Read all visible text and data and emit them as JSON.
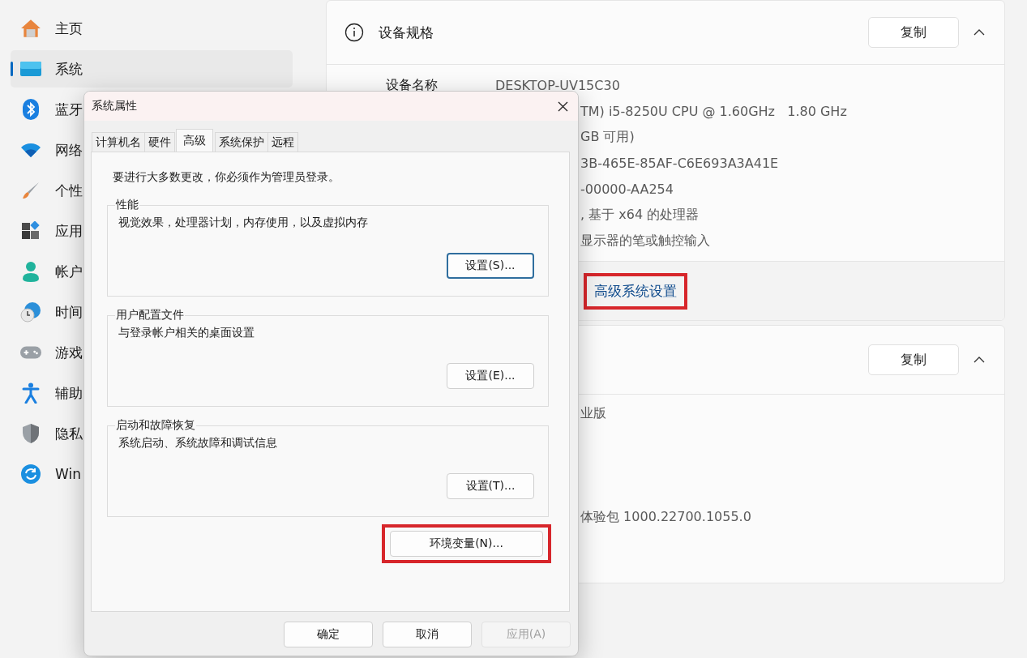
{
  "sidebar": {
    "items": [
      {
        "label": "主页",
        "selected": false
      },
      {
        "label": "系统",
        "selected": true
      },
      {
        "label": "蓝牙",
        "selected": false
      },
      {
        "label": "网络",
        "selected": false
      },
      {
        "label": "个性",
        "selected": false
      },
      {
        "label": "应用",
        "selected": false
      },
      {
        "label": "帐户",
        "selected": false
      },
      {
        "label": "时间",
        "selected": false
      },
      {
        "label": "游戏",
        "selected": false
      },
      {
        "label": "辅助",
        "selected": false
      },
      {
        "label": "隐私",
        "selected": false
      },
      {
        "label": "Win",
        "selected": false
      }
    ]
  },
  "spec_card": {
    "title": "设备规格",
    "copy_button": "复制",
    "expanded": true,
    "rows": [
      {
        "label": "设备名称",
        "value": "DESKTOP-UV15C30"
      },
      {
        "value": "TM) i5-8250U CPU @ 1.60GHz   1.80 GHz"
      },
      {
        "value": "GB 可用)"
      },
      {
        "value": "3B-465E-85AF-C6E693A3A41E"
      },
      {
        "value": "-00000-AA254"
      },
      {
        "value": ", 基于 x64 的处理器"
      },
      {
        "value": "显示器的笔或触控输入"
      }
    ],
    "link": {
      "label": "高级系统设置",
      "highlighted": true
    }
  },
  "os_card": {
    "copy_button": "复制",
    "expanded": true,
    "rows": [
      {
        "value": "业版"
      },
      {
        "value": "体验包 1000.22700.1055.0"
      }
    ]
  },
  "dialog": {
    "title": "系统属性",
    "tabs": [
      {
        "label": "计算机名",
        "selected": false
      },
      {
        "label": "硬件",
        "selected": false
      },
      {
        "label": "高级",
        "selected": true
      },
      {
        "label": "系统保护",
        "selected": false
      },
      {
        "label": "远程",
        "selected": false
      }
    ],
    "notice": "要进行大多数更改，你必须作为管理员登录。",
    "groups": [
      {
        "title": "性能",
        "description": "视觉效果，处理器计划，内存使用，以及虚拟内存",
        "button": "设置(S)...",
        "focused": true
      },
      {
        "title": "用户配置文件",
        "description": "与登录帐户相关的桌面设置",
        "button": "设置(E)...",
        "focused": false
      },
      {
        "title": "启动和故障恢复",
        "description": "系统启动、系统故障和调试信息",
        "button": "设置(T)...",
        "focused": false
      }
    ],
    "env_button": {
      "label": "环境变量(N)...",
      "highlighted": true
    },
    "buttons": [
      {
        "label": "确定",
        "disabled": false
      },
      {
        "label": "取消",
        "disabled": false
      },
      {
        "label": "应用(A)",
        "disabled": true
      }
    ]
  }
}
